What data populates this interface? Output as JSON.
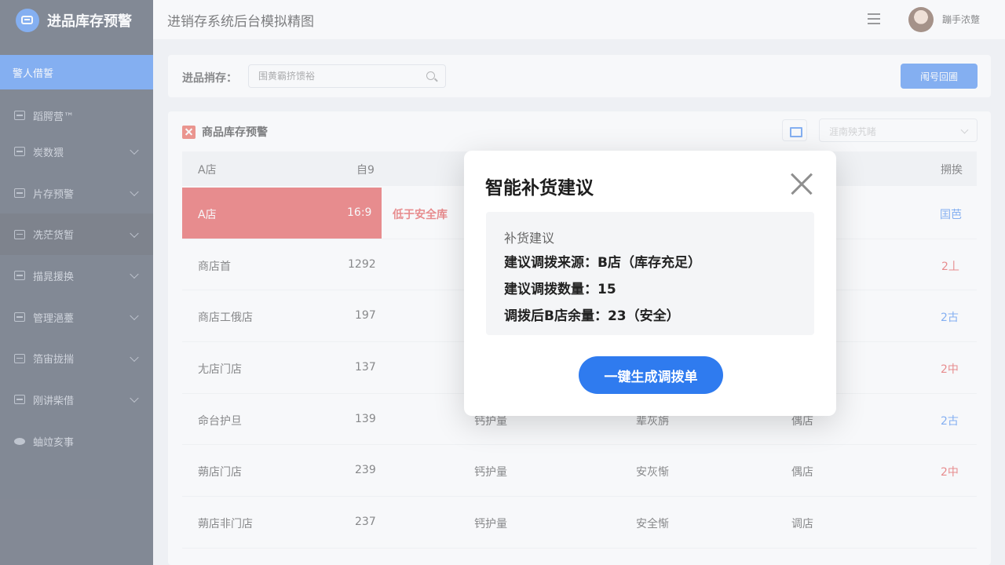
{
  "sidebar": {
    "brand": "进品库存预警",
    "active_item": "警人借誓",
    "items": [
      {
        "label": "蹈腭营™",
        "icon": "home-icon",
        "arrow": false
      },
      {
        "label": "炭数猥",
        "icon": "chart-icon",
        "arrow": true
      },
      {
        "label": "片存预警",
        "icon": "warehouse-icon",
        "arrow": true
      },
      {
        "label": "冼茫货暂",
        "icon": "list-icon",
        "arrow": true
      },
      {
        "label": "描晁援换",
        "icon": "transfer-icon",
        "arrow": true
      },
      {
        "label": "管理浥薹",
        "icon": "manage-icon",
        "arrow": true
      },
      {
        "label": "箔宙拢揣",
        "icon": "store-icon",
        "arrow": true
      },
      {
        "label": "刚讲柴借",
        "icon": "report-icon",
        "arrow": true
      },
      {
        "label": "蚰竝亥事",
        "icon": "eye-icon",
        "arrow": false
      }
    ]
  },
  "header": {
    "title": "进销存系统后台模拟精图",
    "user_name": "蹦手浓蹩"
  },
  "filter": {
    "label": "进品捎存：",
    "placeholder": "围黄霸挤馈裕",
    "button": "闱号回圃"
  },
  "card": {
    "title": "商品库存预警",
    "select_placeholder": "涯南殃艽睹"
  },
  "table": {
    "headers": [
      "A店",
      "自9",
      "搠挨"
    ],
    "rows": [
      {
        "store": "A店",
        "qty": "16:9",
        "c3": "低于安全库",
        "c4": "",
        "c5": "",
        "op": "囯芭",
        "op_color": "blue",
        "alert": true
      },
      {
        "store": "商店首",
        "qty": "1292",
        "c3": "",
        "c4": "",
        "c5": "",
        "op": "2丄",
        "op_color": "red",
        "alert": false
      },
      {
        "store": "商店工俄店",
        "qty": "197",
        "c3": "",
        "c4": "",
        "c5": "",
        "op": "2古",
        "op_color": "blue",
        "alert": false
      },
      {
        "store": "尢店门店",
        "qty": "137",
        "c3": "",
        "c4": "",
        "c5": "",
        "op": "2中",
        "op_color": "red",
        "alert": false
      },
      {
        "store": "命台护旦",
        "qty": "139",
        "c3": "钙护量",
        "c4": "辈灰旃",
        "c5": "偶店",
        "op": "2古",
        "op_color": "blue",
        "alert": false
      },
      {
        "store": "蒴店门店",
        "qty": "239",
        "c3": "钙护量",
        "c4": "安灰惭",
        "c5": "偶店",
        "op": "2中",
        "op_color": "red",
        "alert": false
      },
      {
        "store": "蒴店非门店",
        "qty": "237",
        "c3": "钙护量",
        "c4": "安全惭",
        "c5": "调店",
        "op": "",
        "op_color": "red",
        "alert": false
      }
    ]
  },
  "modal": {
    "title": "智能补货建议",
    "section_label": "补货建议",
    "line1": "建议调拨来源：B店（库存充足）",
    "line2": "建议调拨数量：15",
    "line3": "调拨后B店余量：23（安全）",
    "button": "一键生成调拨单"
  },
  "colors": {
    "primary": "#2f7bef",
    "sidebar_bg": "#2b3547",
    "alert": "#e23b3b"
  }
}
